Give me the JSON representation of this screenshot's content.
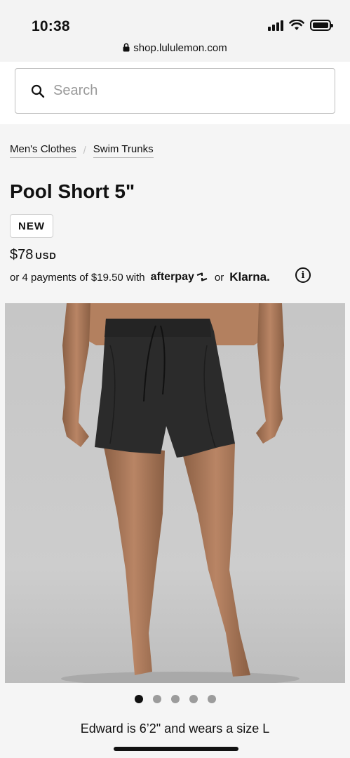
{
  "status_bar": {
    "time": "10:38",
    "url": "shop.lululemon.com",
    "icons": [
      "signal-icon",
      "wifi-icon",
      "battery-icon"
    ]
  },
  "search": {
    "placeholder": "Search",
    "value": "",
    "icon": "search-icon"
  },
  "breadcrumbs": [
    {
      "label": "Men's Clothes"
    },
    {
      "label": "Swim Trunks"
    }
  ],
  "breadcrumb_separator": "/",
  "product": {
    "title": "Pool Short 5\"",
    "badge": "NEW",
    "price": "$78",
    "currency": "USD",
    "payments_text": "or 4 payments of $19.50 with",
    "afterpay_label": "afterpay",
    "or_text": "or",
    "klarna_label": "Klarna.",
    "info_icon": "info-icon"
  },
  "gallery": {
    "image_count": 5,
    "active_index": 0,
    "caption": "Edward is 6’2\" and wears a size L"
  },
  "colors": {
    "background": "#f5f5f5",
    "text": "#111111",
    "image_background": "#c9c9c9",
    "shorts": "#2b2b2b",
    "dot_inactive": "#9c9c9c"
  }
}
